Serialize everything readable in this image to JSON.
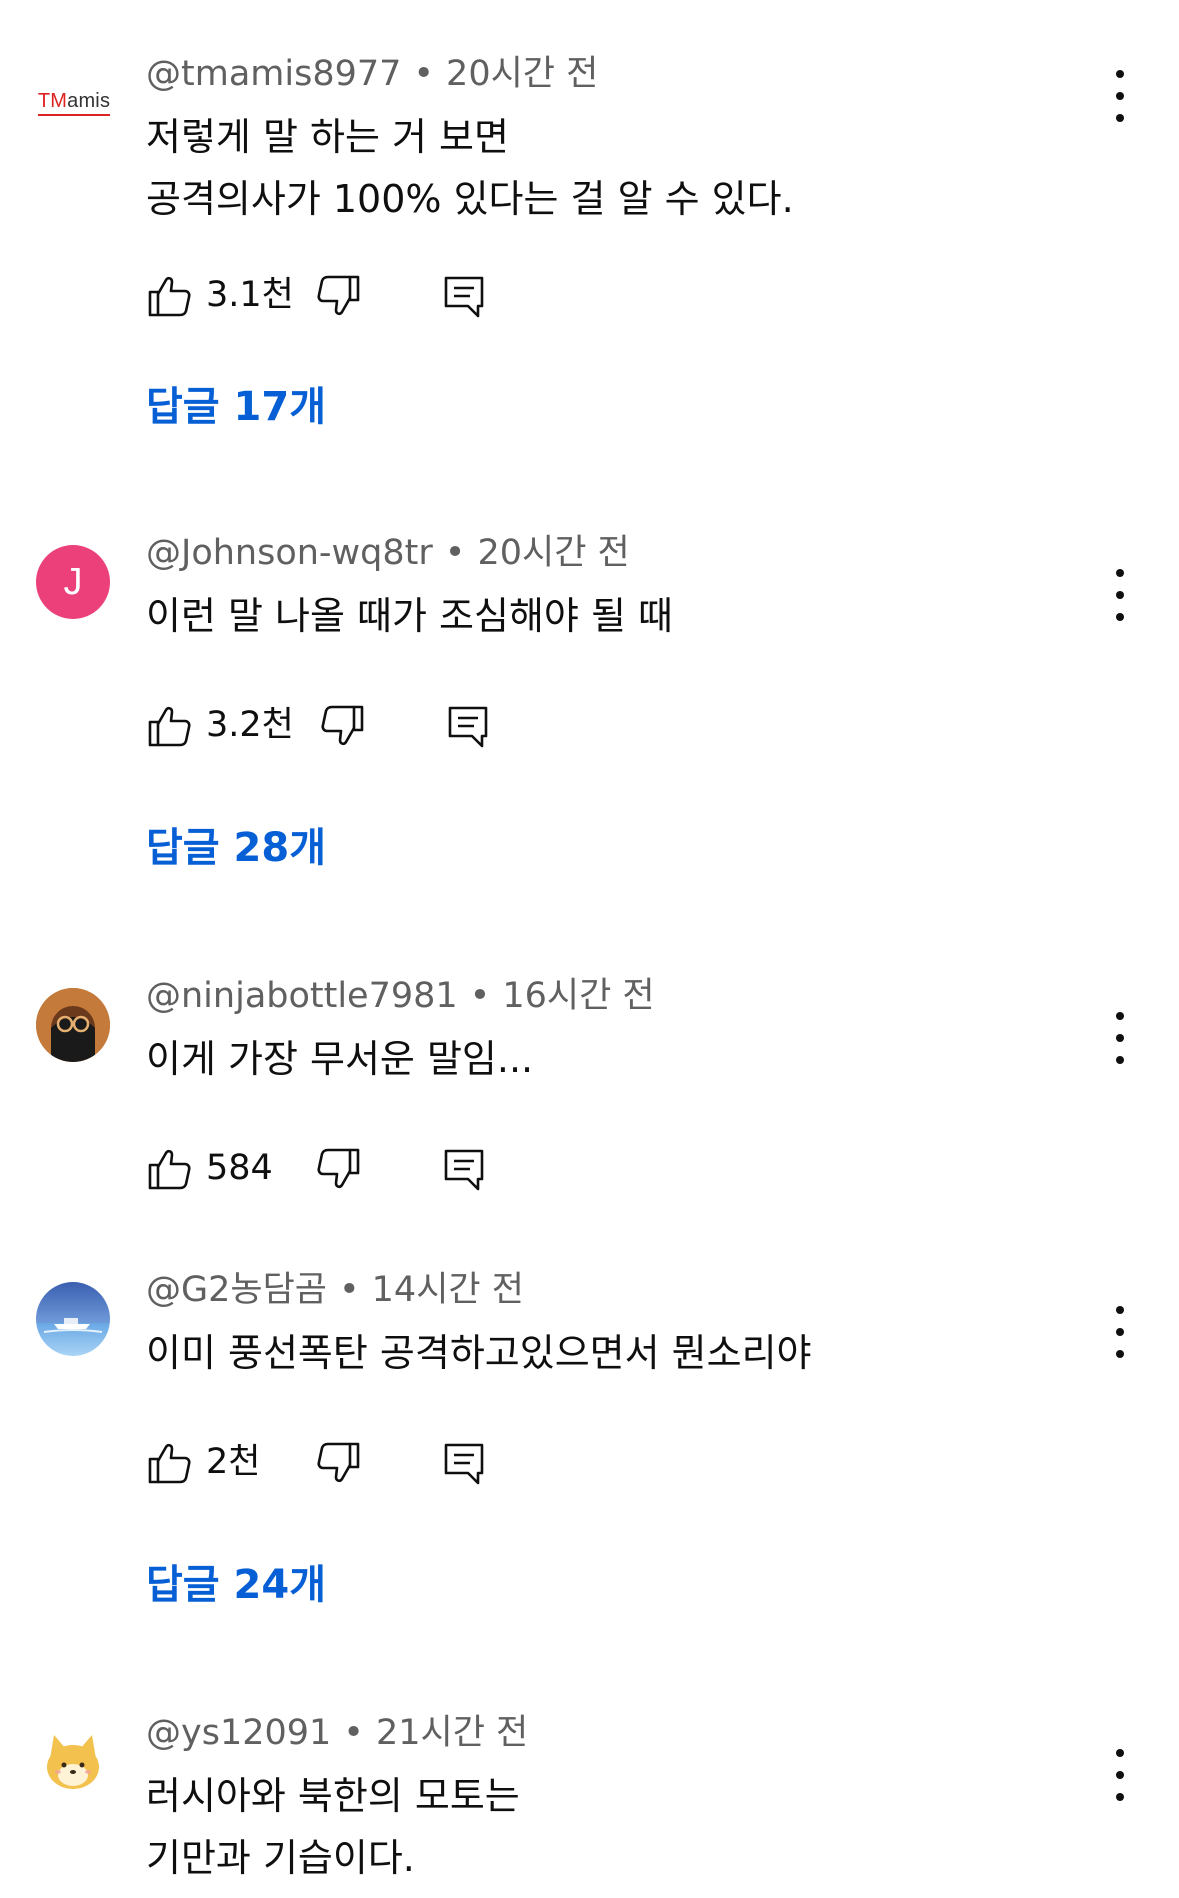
{
  "comments": [
    {
      "author": "@tmamis8977",
      "time": "20시간 전",
      "avatar": {
        "type": "logo",
        "text_prefix": "TM",
        "text_rest": "amis"
      },
      "lines": [
        "저렇게 말 하는 거 보면",
        "공격의사가 100% 있다는 걸 알 수 있다."
      ],
      "likes": "3.1천",
      "replies": "답글 17개"
    },
    {
      "author": "@Johnson-wq8tr",
      "time": "20시간 전",
      "avatar": {
        "type": "letter",
        "letter": "J",
        "color": "#ec407a"
      },
      "lines": [
        "이런 말 나올 때가 조심해야 될 때"
      ],
      "likes": "3.2천",
      "replies": "답글 28개"
    },
    {
      "author": "@ninjabottle7981",
      "time": "16시간 전",
      "avatar": {
        "type": "image",
        "icon": "masked-face-avatar"
      },
      "lines": [
        "이게 가장 무서운 말임..."
      ],
      "likes": "584",
      "replies": ""
    },
    {
      "author": "@G2농담곰",
      "time": "14시간 전",
      "avatar": {
        "type": "image",
        "icon": "boat-on-water-avatar"
      },
      "lines": [
        "이미 풍선폭탄 공격하고있으면서 뭔소리야"
      ],
      "likes": "2천",
      "replies": "답글 24개"
    },
    {
      "author": "@ys12091",
      "time": "21시간 전",
      "avatar": {
        "type": "image",
        "icon": "shiba-dog-avatar"
      },
      "lines": [
        "러시아와 북한의 모토는",
        "기만과 기습이다."
      ],
      "likes": "",
      "replies": ""
    }
  ],
  "icons": {
    "like": "thumbs-up-icon",
    "dislike": "thumbs-down-icon",
    "reply": "reply-comment-icon",
    "more": "more-vertical-icon"
  },
  "colors": {
    "link_blue": "#065fd4",
    "meta_gray": "#606060",
    "text": "#0f0f0f"
  }
}
